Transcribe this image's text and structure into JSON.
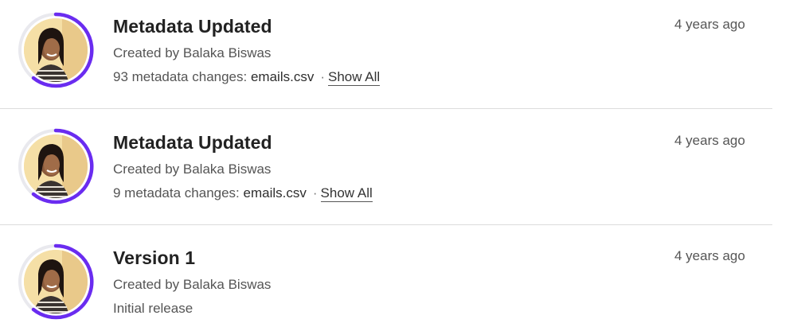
{
  "colors": {
    "ring_accent": "#6a2cf0",
    "ring_track": "#e9e9ee",
    "divider": "#dcdcdc"
  },
  "entries": [
    {
      "title": "Metadata Updated",
      "creator": "Created by Balaka Biswas",
      "changes_text": "93 metadata changes: ",
      "file": "emails.csv",
      "separator": "·",
      "show_all": "Show All",
      "time": "4 years ago",
      "avatar_icon": "user-avatar-photo"
    },
    {
      "title": "Metadata Updated",
      "creator": "Created by Balaka Biswas",
      "changes_text": "9 metadata changes: ",
      "file": "emails.csv",
      "separator": "·",
      "show_all": "Show All",
      "time": "4 years ago",
      "avatar_icon": "user-avatar-photo"
    },
    {
      "title": "Version 1",
      "creator": "Created by Balaka Biswas",
      "description": "Initial release",
      "time": "4 years ago",
      "avatar_icon": "user-avatar-photo"
    }
  ]
}
